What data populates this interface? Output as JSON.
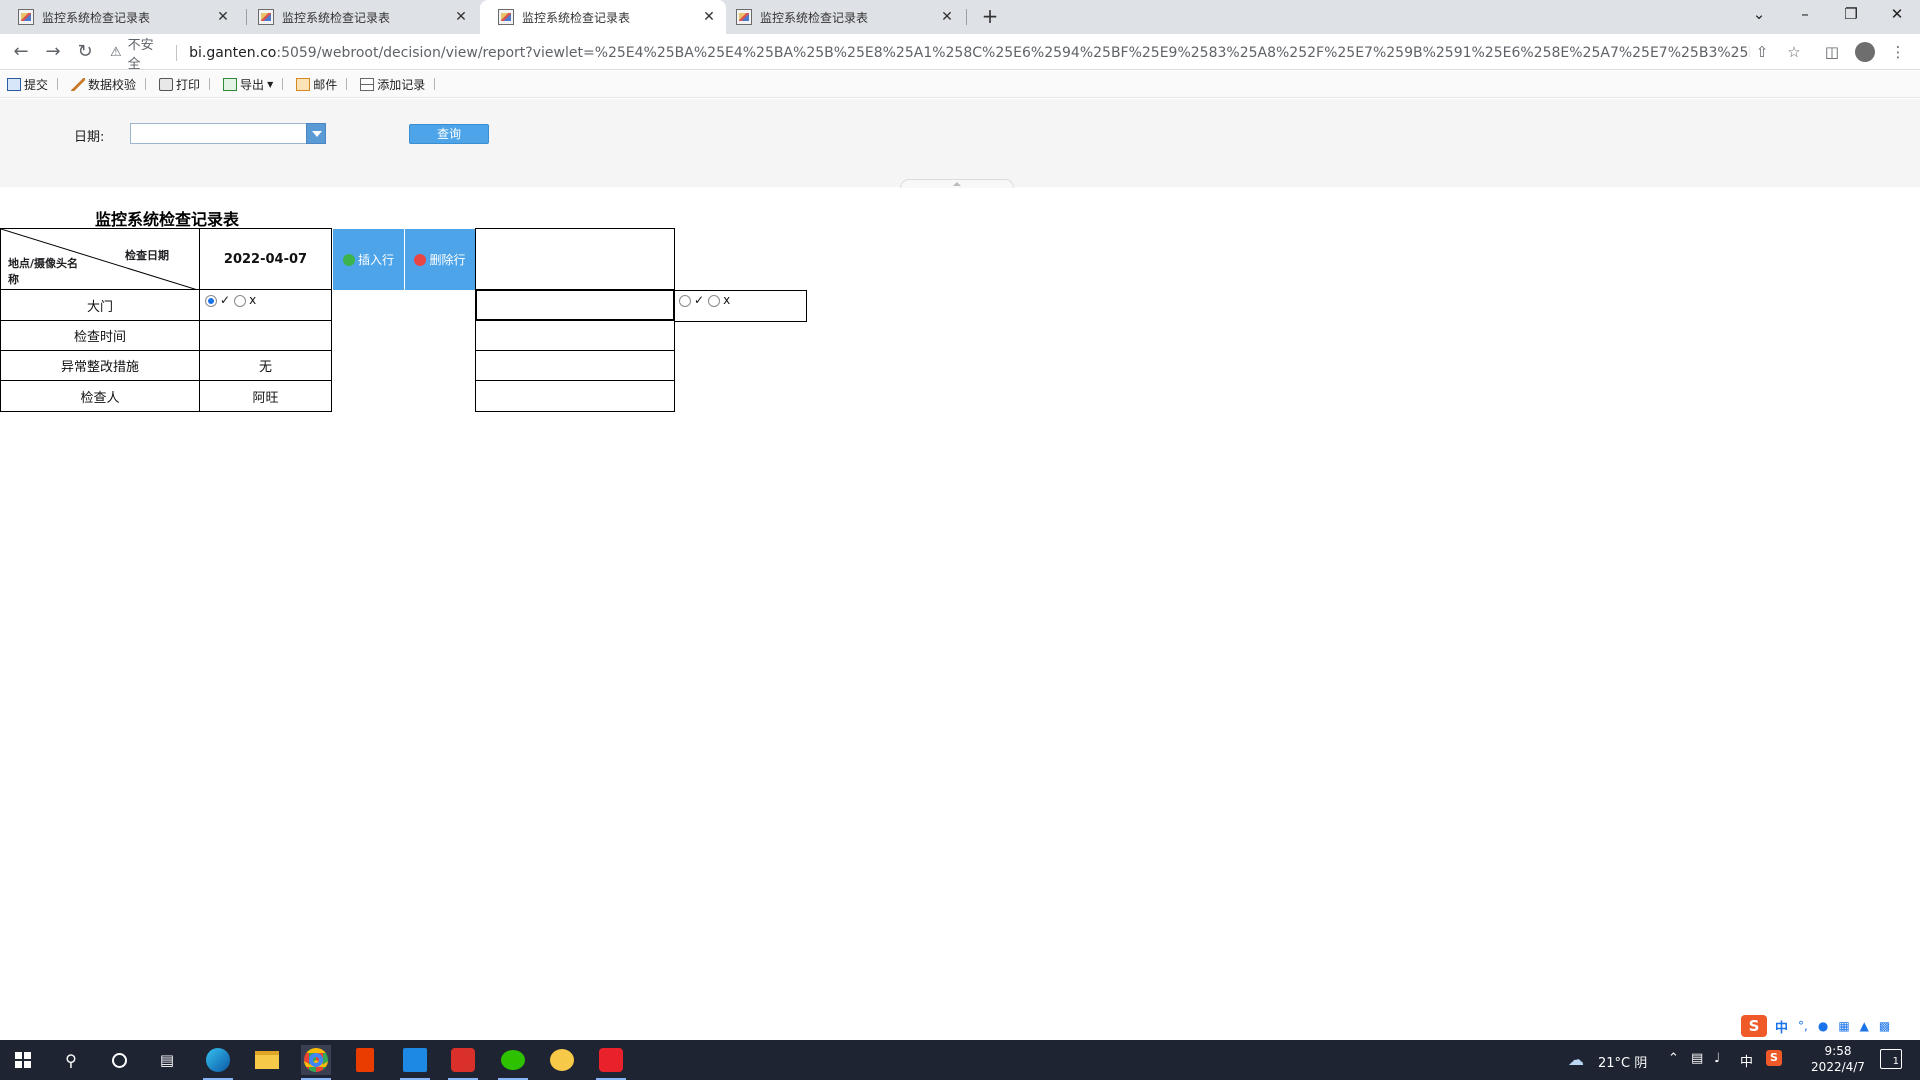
{
  "browser": {
    "tabs": [
      {
        "title": "监控系统检查记录表",
        "active": false
      },
      {
        "title": "监控系统检查记录表",
        "active": false
      },
      {
        "title": "监控系统检查记录表",
        "active": true
      },
      {
        "title": "监控系统检查记录表",
        "active": false
      }
    ],
    "new_tab": "+",
    "window_buttons": {
      "tab_search": "⌄",
      "minimize": "–",
      "restore": "❐",
      "close": "✕"
    },
    "address": {
      "security_warning": "不安全",
      "host": "bi.ganten.co",
      "path": ":5059/webroot/decision/view/report?viewlet=%25E4%25BA%25E4%25BA%25B%25E8%25A1%258C%25E6%2594%25BF%25E9%2583%25A8%252F%25E7%259B%2591%25E6%258E%25A7%25E7%25B3%25B..."
    }
  },
  "toolbar": {
    "submit": "提交",
    "validate": "数据校验",
    "print": "打印",
    "export": "导出",
    "mail": "邮件",
    "add_record": "添加记录"
  },
  "params": {
    "date_label": "日期:",
    "date_value": "",
    "query_button": "查询"
  },
  "report": {
    "title": "监控系统检查记录表",
    "header_top": "检查日期",
    "header_bottom": "地点/摄像头名称",
    "date": "2022-04-07",
    "rows": {
      "gate": "大门",
      "check_time": "检查时间",
      "measures": "异常整改措施",
      "inspector": "检查人"
    },
    "values": {
      "check_time": "",
      "measures": "无",
      "inspector": "阿旺"
    },
    "radio_ok": "✓",
    "radio_bad": "x",
    "insert_row": "插入行",
    "delete_row": "删除行"
  },
  "system": {
    "weather": "21°C 阴",
    "ime_lang": "中",
    "time": "9:58",
    "date": "2022/4/7",
    "notification_count": "1"
  },
  "colors": {
    "accent": "#4da4e8",
    "taskbar": "#1f2432",
    "param_bg": "#f5f5f5"
  }
}
